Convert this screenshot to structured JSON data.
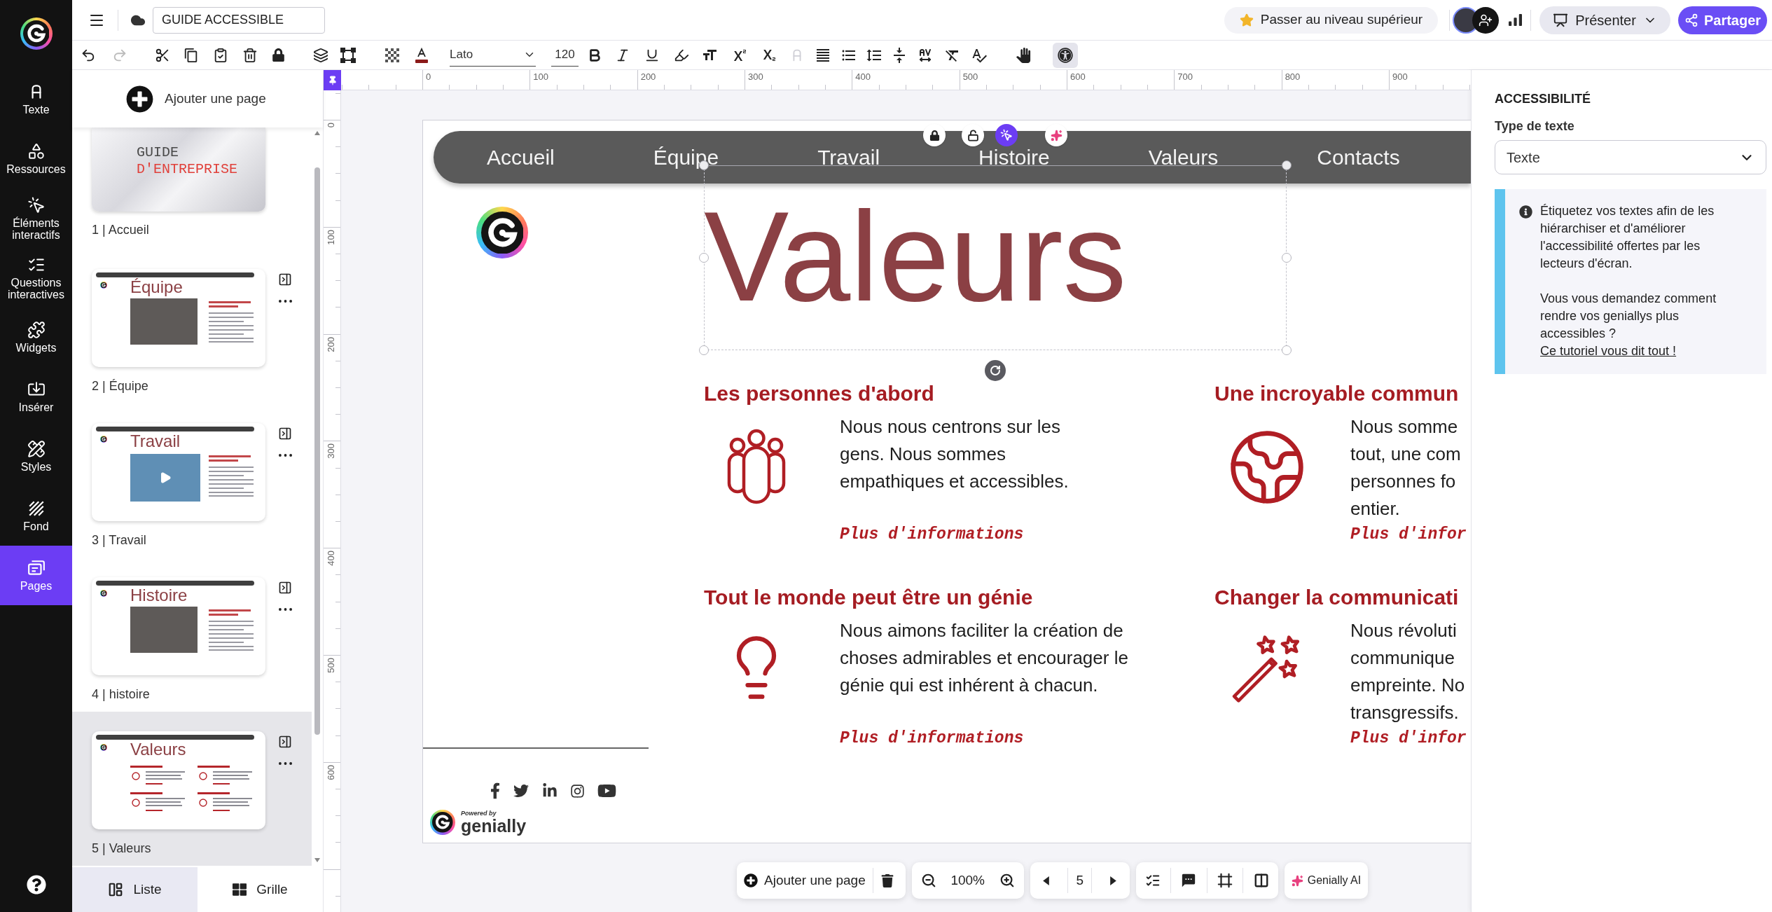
{
  "rail": {
    "items": [
      {
        "label": "Texte",
        "selected": false
      },
      {
        "label": "Ressources",
        "selected": false
      },
      {
        "label": "Éléments interactifs",
        "selected": false
      },
      {
        "label": "Questions interactives",
        "selected": false
      },
      {
        "label": "Widgets",
        "selected": false
      },
      {
        "label": "Insérer",
        "selected": false
      },
      {
        "label": "Styles",
        "selected": false
      },
      {
        "label": "Fond",
        "selected": false
      },
      {
        "label": "Pages",
        "selected": true
      }
    ]
  },
  "top_bar": {
    "title": {
      "value": "GUIDE ACCESSIBLE"
    },
    "upgrade": "Passer au niveau supérieur",
    "present": "Présenter",
    "share": "Partager"
  },
  "toolbar": {
    "font": {
      "value": "Lato"
    },
    "size": {
      "value": "120"
    },
    "accessibility": {
      "selected": true
    }
  },
  "pages_panel": {
    "add_page": "Ajouter une page",
    "pages": [
      {
        "label": "1 | Accueil",
        "selected": false,
        "kind": "cover",
        "title_lines": [
          "GUIDE",
          "D'ENTREPRISE"
        ]
      },
      {
        "label": "2 | Équipe",
        "selected": false,
        "kind": "photo",
        "title": "Équipe"
      },
      {
        "label": "3 | Travail",
        "selected": false,
        "kind": "video",
        "title": "Travail"
      },
      {
        "label": "4 | histoire",
        "selected": false,
        "kind": "photo",
        "title": "Histoire"
      },
      {
        "label": "5 | Valeurs",
        "selected": true,
        "kind": "grid",
        "title": "Valeurs"
      }
    ],
    "view_tabs": [
      {
        "label": "Liste",
        "selected": true
      },
      {
        "label": "Grille",
        "selected": false
      }
    ]
  },
  "ruler": {
    "horizontal": [
      "0",
      "100",
      "200",
      "300",
      "400",
      "500",
      "600",
      "700",
      "800",
      "900"
    ],
    "vertical": [
      "0",
      "100",
      "200",
      "300",
      "400",
      "500",
      "600"
    ]
  },
  "slide": {
    "nav": [
      "Accueil",
      "Équipe",
      "Travail",
      "Histoire",
      "Valeurs",
      "Contacts"
    ],
    "title": {
      "text": "Valeurs",
      "selected": true
    },
    "sections": [
      {
        "heading": "Les personnes d'abord",
        "lines": [
          "Nous nous centrons sur les",
          "gens. Nous sommes",
          "empathiques et accessibles."
        ],
        "link": "Plus d'informations"
      },
      {
        "heading": "Une incroyable commun",
        "lines": [
          "Nous somme",
          "tout, une com",
          "personnes fo",
          "entier."
        ],
        "link": "Plus d'infor"
      },
      {
        "heading": "Tout le monde peut être un génie",
        "lines": [
          "Nous aimons faciliter la création de",
          "choses admirables et encourager le",
          "génie qui est inhérent à chacun."
        ],
        "link": "Plus d'informations"
      },
      {
        "heading": "Changer la communicati",
        "lines": [
          "Nous révoluti",
          "communique",
          "empreinte. No",
          "transgressifs."
        ],
        "link": "Plus d'infor"
      }
    ],
    "footer": {
      "powered_by": "Powered by",
      "brand": "genially"
    }
  },
  "bottom_bar": {
    "add_page": "Ajouter une page",
    "zoom": "100%",
    "page": "5",
    "ai": "Genially AI"
  },
  "accessibility_panel": {
    "title": "ACCESSIBILITÉ",
    "type_label": "Type de texte",
    "type_select": {
      "value": "Texte"
    },
    "info": {
      "paragraphs": [
        "Étiquetez vos textes afin de les hiérarchiser et d'améliorer l'accessibilité offertes par les lecteurs d'écran.",
        "Vous vous demandez comment rendre vos geniallys plus accessibles ?"
      ],
      "link": "Ce tutoriel vous dit tout !"
    }
  }
}
